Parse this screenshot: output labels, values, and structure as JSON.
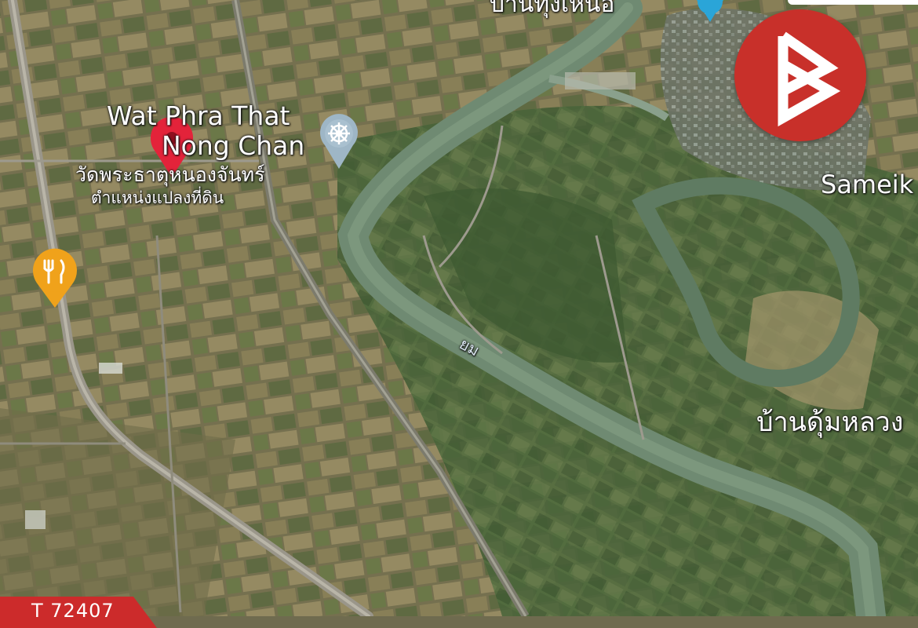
{
  "map": {
    "top_label": "บ้านทุ่งเหนือ",
    "temple_name_en_line1": "Wat Phra That",
    "temple_name_en_line2": "Nong Chan",
    "temple_name_th": "วัดพระธาตุหนองจันทร์",
    "plot_location_th": "ตำแหน่งแปลงที่ดิน",
    "town_label": "Sameik",
    "river_label": "ยม",
    "village_label": "บ้านดุ้มหลวง",
    "listing_id": "T 72407"
  },
  "colors": {
    "brand_red": "#c8302a",
    "pin_red": "#e3233a",
    "restaurant_orange": "#f0a21b",
    "temple_marker": "#9eb6c6",
    "river": "#6f8a72",
    "road": "#9a968a",
    "tab_red": "#cc2b2b"
  },
  "icons": {
    "location_pin": "map-pin-icon",
    "restaurant": "fork-knife-icon",
    "temple": "dharma-wheel-icon",
    "brand_logo": "b-logo-icon",
    "top_marker": "blue-pin-icon"
  }
}
